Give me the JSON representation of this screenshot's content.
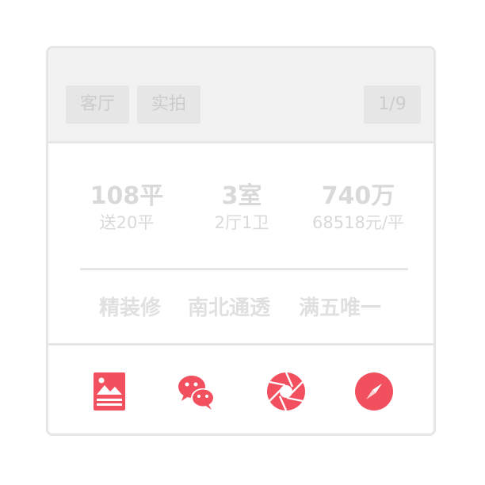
{
  "header": {
    "tags": [
      "客厅",
      "实拍"
    ],
    "page_counter": "1/9"
  },
  "stats": {
    "area": {
      "main": "108平",
      "sub": "送20平"
    },
    "rooms": {
      "main": "3室",
      "sub": "2厅1卫"
    },
    "price": {
      "main": "740万",
      "sub": "68518元/平"
    }
  },
  "features": [
    "精装修",
    "南北通透",
    "满五唯一"
  ],
  "actions": {
    "icons": [
      "image-poster-icon",
      "wechat-icon",
      "camera-aperture-icon",
      "compass-icon"
    ]
  },
  "colors": {
    "accent": "#f2505f",
    "muted_text": "#d9d9d9",
    "header_bg": "#f2f2f2",
    "border": "#e6e6e6"
  }
}
